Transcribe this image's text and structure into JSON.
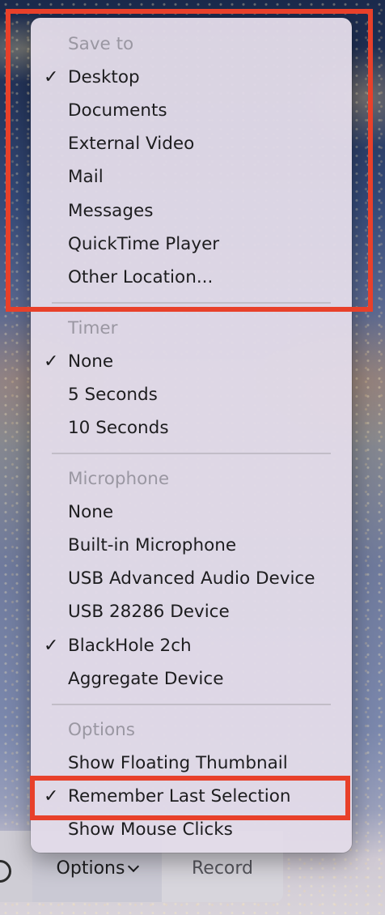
{
  "menu": {
    "save_to": {
      "header": "Save to",
      "items": [
        {
          "label": "Desktop",
          "checked": true
        },
        {
          "label": "Documents",
          "checked": false
        },
        {
          "label": "External Video",
          "checked": false
        },
        {
          "label": "Mail",
          "checked": false
        },
        {
          "label": "Messages",
          "checked": false
        },
        {
          "label": "QuickTime Player",
          "checked": false
        },
        {
          "label": "Other Location...",
          "checked": false
        }
      ]
    },
    "timer": {
      "header": "Timer",
      "items": [
        {
          "label": "None",
          "checked": true
        },
        {
          "label": "5 Seconds",
          "checked": false
        },
        {
          "label": "10 Seconds",
          "checked": false
        }
      ]
    },
    "microphone": {
      "header": "Microphone",
      "items": [
        {
          "label": "None",
          "checked": false
        },
        {
          "label": "Built-in Microphone",
          "checked": false
        },
        {
          "label": "USB Advanced Audio Device",
          "checked": false
        },
        {
          "label": "USB 28286 Device",
          "checked": false
        },
        {
          "label": "BlackHole 2ch",
          "checked": true
        },
        {
          "label": "Aggregate Device",
          "checked": false
        }
      ]
    },
    "options": {
      "header": "Options",
      "items": [
        {
          "label": "Show Floating Thumbnail",
          "checked": false
        },
        {
          "label": "Remember Last Selection",
          "checked": true
        },
        {
          "label": "Show Mouse Clicks",
          "checked": false
        }
      ]
    },
    "check_glyph": "✓"
  },
  "toolbar": {
    "options_label": "Options",
    "record_label": "Record"
  },
  "colors": {
    "annotation": "#e8402a",
    "menu_background": "#e2dbe8",
    "header_text": "#9a97a2",
    "item_text": "#1d1d1f"
  },
  "icons": {
    "check": "checkmark-icon",
    "chevron": "chevron-down-icon",
    "record": "record-circle-icon"
  }
}
